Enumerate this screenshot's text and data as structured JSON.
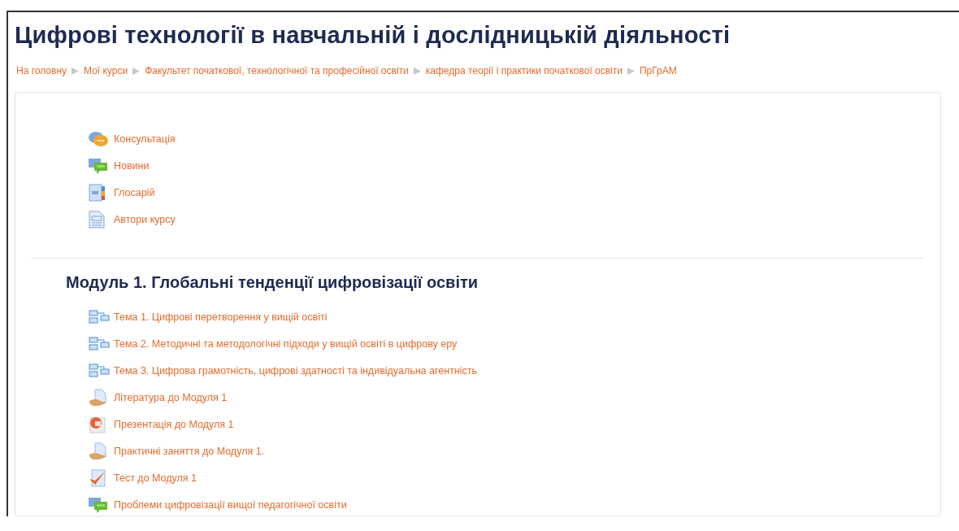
{
  "course_title": "Цифрові технології в навчальній і дослідницькій діяльності",
  "breadcrumb": [
    {
      "label": "На головну"
    },
    {
      "label": "Мої курси"
    },
    {
      "label": "Факультет початкової, технологічної та професійної освіти"
    },
    {
      "label": "кафедра теорії і практики початкової освіти"
    },
    {
      "label": "ПрГрАМ"
    }
  ],
  "sections": [
    {
      "activities": [
        {
          "kind": "chat",
          "label": "Консультація"
        },
        {
          "kind": "forum",
          "label": "Новини"
        },
        {
          "kind": "glossary",
          "label": "Глосарій"
        },
        {
          "kind": "page",
          "label": "Автори курсу"
        }
      ]
    },
    {
      "title": "Модуль 1. Глобальні тенденції цифровізації освіти",
      "activities": [
        {
          "kind": "subsection",
          "label": "Тема 1. Цифрові перетворення у вищій освіті"
        },
        {
          "kind": "subsection",
          "label": "Тема 2. Методичні та методологічні підходи у вищій освіті в цифрову еру"
        },
        {
          "kind": "subsection",
          "label": "Тема 3. Цифрова грамотність, цифрові здатності та індивідуальна агентність"
        },
        {
          "kind": "resource",
          "label": "Література до Модуля 1"
        },
        {
          "kind": "presentation",
          "label": "Презентація до Модуля 1"
        },
        {
          "kind": "resource",
          "label": "Практичні заняття до Модуля 1."
        },
        {
          "kind": "quiz",
          "label": "Тест до Модуля 1"
        },
        {
          "kind": "forum",
          "label": "Проблеми цифровізації вищої педагогічної освіти"
        }
      ]
    }
  ]
}
